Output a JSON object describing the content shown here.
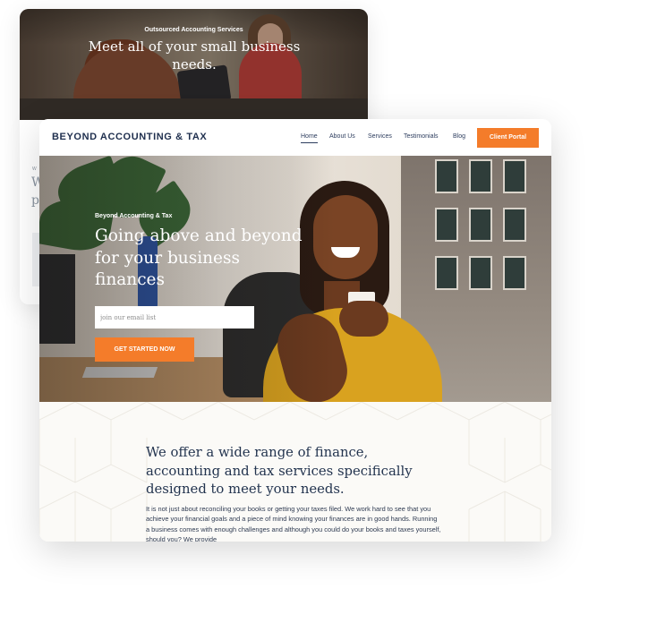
{
  "back_card": {
    "eyebrow": "Outsourced Accounting Services",
    "title": "Meet all of your small business needs.",
    "fragment_small": "W",
    "fragment_a": "W",
    "fragment_b": "p"
  },
  "nav": {
    "logo": "BEYOND ACCOUNTING & TAX",
    "items": [
      "Home",
      "About Us",
      "Services",
      "Testimonials",
      "Blog"
    ],
    "active_item": "Home",
    "cta": "Client Portal"
  },
  "hero": {
    "eyebrow": "Beyond Accounting & Tax",
    "title": "Going above and beyond for your business finances",
    "email_placeholder": "join our email list",
    "button": "GET STARTED NOW"
  },
  "about": {
    "title": "We offer a wide range of finance, accounting and tax services specifically designed to meet your needs.",
    "body": "It is not just about reconciling your books or getting your taxes filed. We work hard to see that you achieve your financial goals and a piece of mind knowing your finances are in good hands. Running a business comes with enough challenges and although you could do your books and taxes yourself, should you? We provide"
  },
  "colors": {
    "accent": "#f47c2a",
    "navy": "#1f2f4e"
  }
}
